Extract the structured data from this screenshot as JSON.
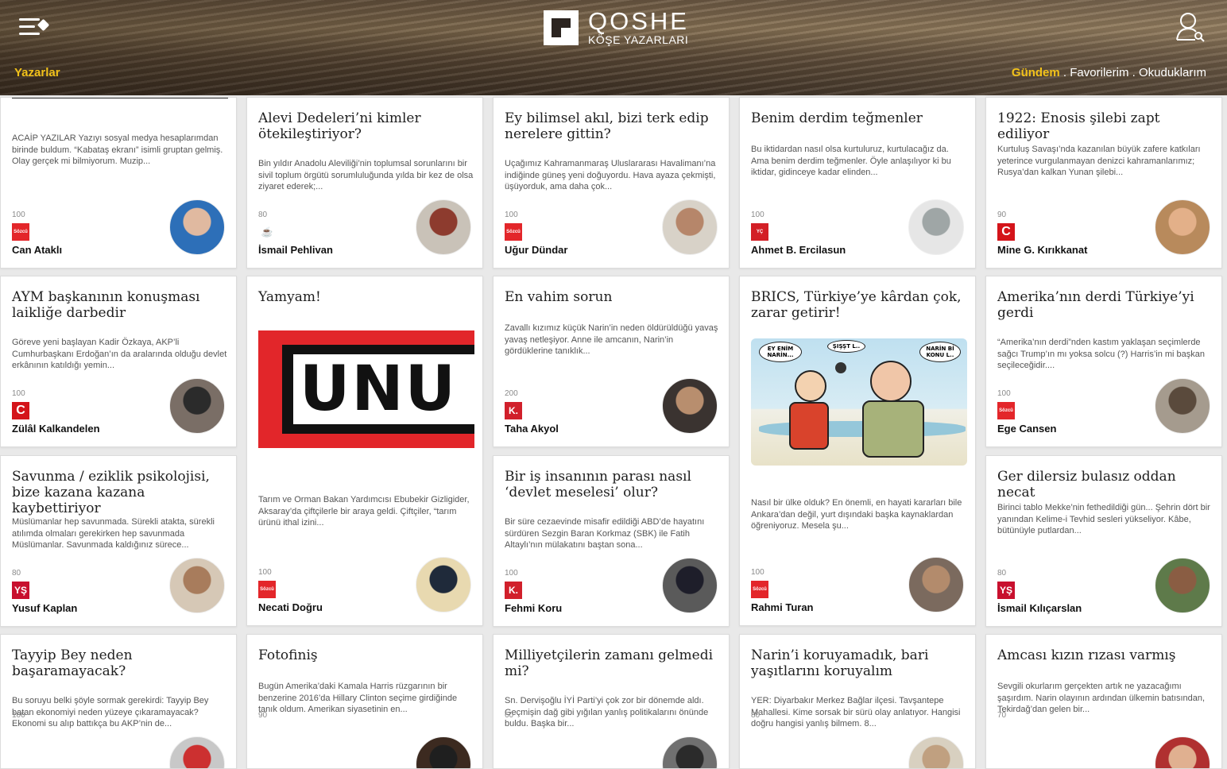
{
  "header": {
    "logo_title": "QOSHE",
    "logo_subtitle": "KÖŞE YAZARLARI",
    "left_link": "Yazarlar",
    "nav": [
      {
        "label": "Gündem",
        "active": true
      },
      {
        "label": "Favorilerim",
        "active": false
      },
      {
        "label": "Okuduklarım",
        "active": false
      }
    ],
    "nav_separator": " . "
  },
  "cards": [
    {
      "col": 0,
      "title": "",
      "excerpt": "ACAİP YAZILAR Yazıyı sosyal medya hesaplarımdan birinde buldum. “Kabataş ekranı” isimli gruptan gelmiş. Olay gerçek mi bilmiyorum. Muzip...",
      "score": "100",
      "pub": "Sözcü",
      "author": "Can Ataklı"
    },
    {
      "col": 1,
      "title": "Alevi Dedeleri’ni kimler ötekileştiriyor?",
      "excerpt": "Bin yıldır Anadolu Aleviliği’nin toplumsal sorunlarını bir sivil toplum örgütü sorumluluğunda yılda bir kez de olsa ziyaret ederek;...",
      "score": "80",
      "pub": "Kahvesi",
      "author": "İsmail Pehlivan"
    },
    {
      "col": 2,
      "title": "Ey bilimsel akıl, bizi terk edip nerelere gittin?",
      "excerpt": "Uçağımız Kahramanmaraş Uluslararası Havalimanı’na indiğinde güneş yeni doğuyordu. Hava ayaza çekmişti, üşüyorduk, ama daha çok...",
      "score": "100",
      "pub": "Sözcü",
      "author": "Uğur Dündar"
    },
    {
      "col": 3,
      "title": "Benim derdim teğmenler",
      "excerpt": "Bu iktidardan nasıl olsa kurtuluruz, kurtulacağız da. Ama benim derdim teğmenler. Öyle anlaşılıyor ki bu iktidar, gidinceye kadar elinden...",
      "score": "100",
      "pub": "Yeniçağ",
      "author": "Ahmet B. Ercilasun"
    },
    {
      "col": 4,
      "title": "1922: Enosis şilebi zapt ediliyor",
      "excerpt": "Kurtuluş Savaşı’nda kazanılan büyük zafere katkıları yeterince vurgulanmayan denizci kahramanlarımız; Rusya’dan kalkan Yunan şilebi...",
      "score": "90",
      "pub": "Cumhuriyet",
      "author": "Mine G. Kırıkkanat"
    },
    {
      "col": 0,
      "title": "AYM başkanının konuşması laikliğe darbedir",
      "excerpt": "Göreve yeni başlayan Kadir Özkaya, AKP’li Cumhurbaşkanı Erdoğan’ın da aralarında olduğu devlet erkânının katıldığı yemin...",
      "score": "100",
      "pub": "Cumhuriyet",
      "author": "Zülâl Kalkandelen"
    },
    {
      "col": 1,
      "title": "Yamyam!",
      "excerpt": "Tarım ve Orman Bakan Yardımcısı Ebubekir Gizligider, Aksaray’da çiftçilerle bir araya geldi. Çiftçiler, “tarım ürünü ithal izini...",
      "score": "100",
      "pub": "Sözcü",
      "author": "Necati Doğru",
      "image_text": "UNU"
    },
    {
      "col": 2,
      "title": "En vahim sorun",
      "excerpt": "Zavallı kızımız küçük Narin’in neden öldürüldüğü yavaş yavaş netleşiyor. Anne ile amcanın, Narin’in gördüklerine tanıklık...",
      "score": "200",
      "pub": "Karar",
      "author": "Taha Akyol"
    },
    {
      "col": 3,
      "title": "BRICS, Türkiye’ye kârdan çok, zarar getirir!",
      "excerpt": "Nasıl bir ülke olduk? En önemli, en hayati kararları bile Ankara’dan değil, yurt dışındaki başka kaynaklardan öğreniyoruz. Mesela şu...",
      "score": "100",
      "pub": "Sözcü",
      "author": "Rahmi Turan",
      "cartoon_bubbles": [
        "EY ENİM NARİN...",
        "ŞIŞŞT L..",
        "NARİN Bİ KONU L.."
      ]
    },
    {
      "col": 4,
      "title": "Amerika’nın derdi Türkiye’yi gerdi",
      "excerpt": "“Amerika’nın derdi”nden kastım yaklaşan seçimlerde sağcı Trump’ın mı yoksa solcu (?) Harris’in mi başkan seçileceğidir....",
      "score": "100",
      "pub": "Sözcü",
      "author": "Ege Cansen"
    },
    {
      "col": 0,
      "title": "Savunma / eziklik psikolojisi, bize kazana kazana kaybettiriyor",
      "excerpt": "Müslümanlar hep savunmada. Sürekli atakta, sürekli atılımda olmaları gerekirken hep savunmada Müslümanlar. Savunmada kaldığınız sürece...",
      "score": "80",
      "pub": "YŞ",
      "author": "Yusuf Kaplan"
    },
    {
      "col": 2,
      "title": "Bir iş insanının parası nasıl ‘devlet meselesi’ olur?",
      "excerpt": "Bir süre cezaevinde misafir edildiği ABD’de hayatını sürdüren Sezgin Baran Korkmaz (SBK) ile Fatih Altaylı’nın mülakatını baştan sona...",
      "score": "100",
      "pub": "Karar",
      "author": "Fehmi Koru"
    },
    {
      "col": 4,
      "title": "Ger dilersiz bulasız oddan necat",
      "excerpt": "Birinci tablo Mekke’nin fethedildiği gün... Şehrin dört bir yanından Kelime-i Tevhid sesleri yükseliyor. Kâbe, bütünüyle putlardan...",
      "score": "80",
      "pub": "YŞ",
      "author": "İsmail Kılıçarslan"
    },
    {
      "col": 0,
      "title": "Tayyip Bey neden başaramayacak?",
      "excerpt": "Bu soruyu belki şöyle sormak gerekirdi: Tayyip Bey batan ekonomiyi neden yüzeye çıkaramayacak? Ekonomi su alıp battıkça bu AKP’nin de...",
      "score": "100",
      "pub": "",
      "author": ""
    },
    {
      "col": 1,
      "title": "Fotofiniş",
      "excerpt": "Bugün Amerika’daki Kamala Harris rüzgarının bir benzerine 2016’da Hillary Clinton seçime girdiğinde tanık oldum. Amerikan siyasetinin en...",
      "score": "90",
      "pub": "",
      "author": ""
    },
    {
      "col": 2,
      "title": "Milliyetçilerin zamanı gelmedi mi?",
      "excerpt": "Sn. Dervişoğlu İYİ Parti’yi çok zor bir dönemde aldı. Geçmişin dağ gibi yığılan yanlış politikalarını önünde buldu. Başka bir...",
      "score": "60",
      "pub": "",
      "author": ""
    },
    {
      "col": 3,
      "title": "Narin’i koruyamadık, bari yaşıtlarını koruyalım",
      "excerpt": "YER: Diyarbakır Merkez Bağlar ilçesi. Tavşantepe Mahallesi. Kime sorsak bir sürü olay anlatıyor. Hangisi doğru hangisi yanlış bilmem. 8...",
      "score": "80",
      "pub": "",
      "author": ""
    },
    {
      "col": 4,
      "title": "Amcası kızın rızası varmış",
      "excerpt": "Sevgili okurlarım gerçekten artık ne yazacağımı şaşırdım. Narin olayının ardından ülkemin batısından, Tekirdağ’dan gelen bir...",
      "score": "70",
      "pub": "",
      "author": ""
    }
  ],
  "colors": {
    "accent": "#f2c21a",
    "sozcu": "#e3262a",
    "cumhuriyet": "#d4141a",
    "karar": "#d1202b",
    "yenicag": "#d31f26",
    "ys": "#c8102e"
  }
}
